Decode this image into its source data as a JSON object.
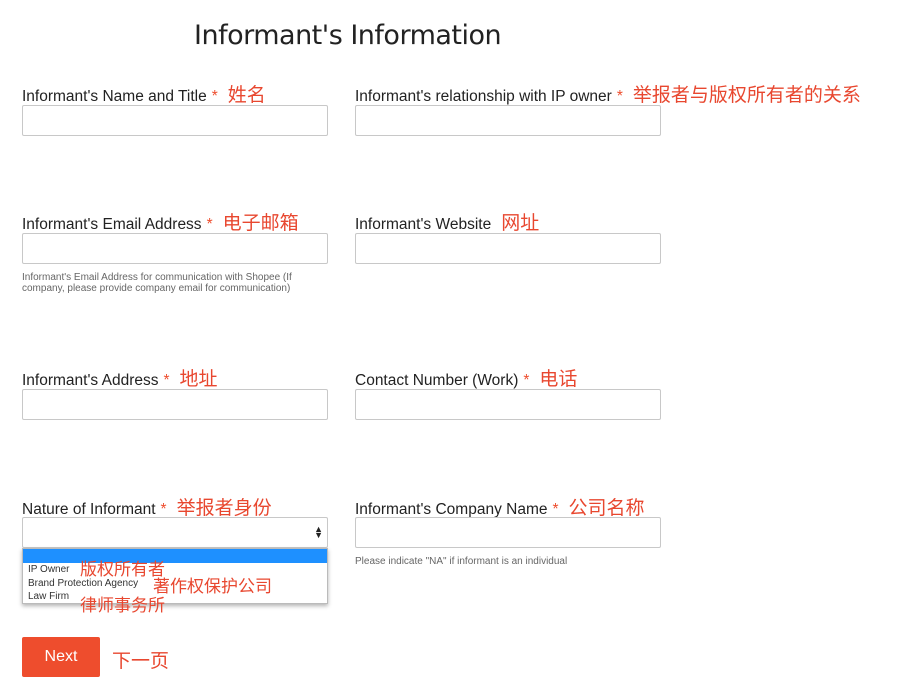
{
  "title": "Informant's Information",
  "fields": [
    {
      "label": "Informant's Name and Title",
      "required": "*",
      "annotation": "姓名",
      "value": ""
    },
    {
      "label": "Informant's relationship with IP owner",
      "required": "*",
      "annotation": "举报者与版权所有者的关系",
      "value": ""
    },
    {
      "label": "Informant's Email Address",
      "required": "*",
      "annotation": "电子邮箱",
      "value": "",
      "help": "Informant's Email Address for communication with Shopee (If company, please provide company email for communication)"
    },
    {
      "label": "Informant's Website",
      "required": "",
      "annotation": "网址",
      "value": ""
    },
    {
      "label": "Informant's Address",
      "required": "*",
      "annotation": "地址",
      "value": ""
    },
    {
      "label": "Contact Number (Work)",
      "required": "*",
      "annotation": "电话",
      "value": ""
    },
    {
      "label": "Nature of Informant",
      "required": "*",
      "annotation": "举报者身份",
      "value": ""
    },
    {
      "label": "Informant's Company Name",
      "required": "*",
      "annotation": "公司名称",
      "value": "",
      "help": "Please indicate \"NA\" if informant is an individual"
    }
  ],
  "dropdown": {
    "options": [
      "IP Owner",
      "Brand Protection Agency",
      "Law Firm"
    ],
    "annotations": [
      "版权所有者",
      "著作权保护公司",
      "律师事务所"
    ]
  },
  "next": {
    "label": "Next",
    "annotation": "下一页"
  },
  "colors": {
    "accent": "#ee4d2d",
    "highlight": "#1e90ff"
  }
}
